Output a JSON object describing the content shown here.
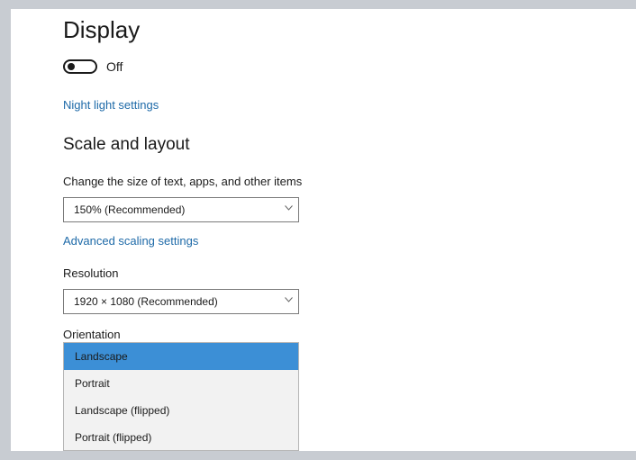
{
  "page": {
    "title": "Display",
    "toggle_state": "Off",
    "night_light_link": "Night light settings",
    "scale_heading": "Scale and layout",
    "size_label": "Change the size of text, apps, and other items",
    "scale_value": "150% (Recommended)",
    "advanced_link": "Advanced scaling settings",
    "resolution_label": "Resolution",
    "resolution_value": "1920 × 1080 (Recommended)",
    "orientation_label": "Orientation",
    "orientation_options": [
      {
        "label": "Landscape",
        "selected": true
      },
      {
        "label": "Portrait",
        "selected": false
      },
      {
        "label": "Landscape (flipped)",
        "selected": false
      },
      {
        "label": "Portrait (flipped)",
        "selected": false
      }
    ]
  },
  "colors": {
    "link": "#1e6aa8",
    "selection": "#3c8fd6"
  },
  "icons": {
    "toggle": "toggle-switch-icon",
    "dropdown": "chevron-down-icon"
  }
}
